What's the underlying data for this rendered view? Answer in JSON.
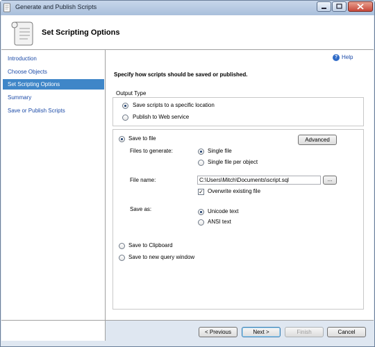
{
  "window": {
    "title": "Generate and Publish Scripts"
  },
  "header": {
    "title": "Set Scripting Options"
  },
  "sidebar": {
    "items": [
      {
        "label": "Introduction",
        "active": false
      },
      {
        "label": "Choose Objects",
        "active": false
      },
      {
        "label": "Set Scripting Options",
        "active": true
      },
      {
        "label": "Summary",
        "active": false
      },
      {
        "label": "Save or Publish Scripts",
        "active": false
      }
    ]
  },
  "main": {
    "help_label": "Help",
    "instruction": "Specify how scripts should be saved or published.",
    "output_type": {
      "label": "Output Type",
      "options": [
        {
          "label": "Save scripts to a specific location",
          "selected": true
        },
        {
          "label": "Publish to Web service",
          "selected": false
        }
      ]
    },
    "save_to_file": {
      "label": "Save to file",
      "selected": true
    },
    "advanced_label": "Advanced",
    "files_to_generate": {
      "label": "Files to generate:",
      "options": [
        {
          "label": "Single file",
          "selected": true
        },
        {
          "label": "Single file per object",
          "selected": false
        }
      ]
    },
    "file_name": {
      "label": "File name:",
      "value": "C:\\Users\\Mitch\\Documents\\script.sql",
      "browse_label": "..."
    },
    "overwrite": {
      "label": "Overwrite existing file",
      "checked": true,
      "check_glyph": "✓"
    },
    "save_as": {
      "label": "Save as:",
      "options": [
        {
          "label": "Unicode text",
          "selected": true
        },
        {
          "label": "ANSI text",
          "selected": false
        }
      ]
    },
    "save_to_clipboard": {
      "label": "Save to Clipboard",
      "selected": false
    },
    "save_to_query_window": {
      "label": "Save to new query window",
      "selected": false
    }
  },
  "footer": {
    "previous_label": "< Previous",
    "next_label": "Next >",
    "finish_label": "Finish",
    "cancel_label": "Cancel"
  },
  "colors": {
    "accent": "#3f86c8",
    "link": "#1c4ba8"
  }
}
